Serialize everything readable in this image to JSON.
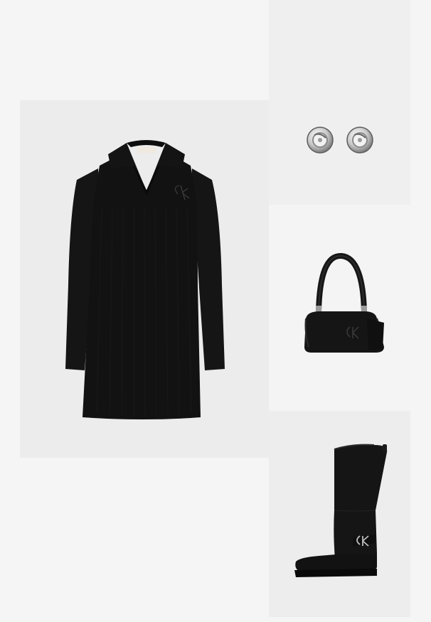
{
  "outfit": {
    "items": [
      {
        "id": "dress",
        "product": "black-ribbed-polo-collar-long-sleeve-dress",
        "color": "#121212"
      },
      {
        "id": "earring",
        "product": "silver-stud-earrings",
        "color": "#c9c9c9"
      },
      {
        "id": "bag",
        "product": "black-leather-shoulder-bag",
        "color": "#151515"
      },
      {
        "id": "boot",
        "product": "black-leather-knee-high-boot",
        "color": "#141414"
      }
    ],
    "background_color": "#f5f5f5",
    "tile_colors": {
      "dress": "#ececec",
      "earring": "#efefef",
      "bag": "#f4f4f4",
      "boot": "#ededed"
    }
  }
}
